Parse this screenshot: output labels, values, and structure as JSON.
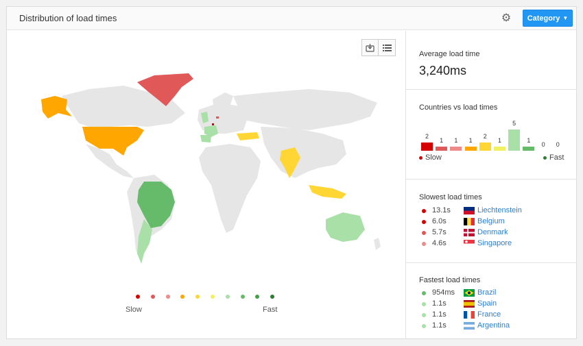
{
  "header": {
    "title": "Distribution of load times",
    "settings_icon": "gear-icon",
    "category_button": "Category"
  },
  "map": {
    "tools": [
      "export-icon",
      "menu-list-icon"
    ],
    "legend": {
      "slow_label": "Slow",
      "fast_label": "Fast"
    },
    "scale_colors": [
      "#d50000",
      "#e05858",
      "#ef8a8a",
      "#ffa700",
      "#ffd633",
      "#f0f060",
      "#a8e0a8",
      "#66bb6a",
      "#43a047",
      "#2e7d32"
    ]
  },
  "average": {
    "title": "Average load time",
    "value": "3,240ms"
  },
  "countries_vs_load": {
    "title": "Countries vs load times",
    "values": [
      2,
      1,
      1,
      1,
      2,
      1,
      5,
      1,
      0,
      0
    ],
    "colors": [
      "#d50000",
      "#e05858",
      "#ef8a8a",
      "#ffa700",
      "#ffd633",
      "#f0f060",
      "#a8e0a8",
      "#66bb6a",
      "#43a047",
      "#2e7d32"
    ],
    "slow_label": "Slow",
    "fast_label": "Fast"
  },
  "slowest": {
    "title": "Slowest load times",
    "rows": [
      {
        "time": "13.1s",
        "country": "Liechtenstein",
        "color": "#d50000"
      },
      {
        "time": "6.0s",
        "country": "Belgium",
        "color": "#d50000"
      },
      {
        "time": "5.7s",
        "country": "Denmark",
        "color": "#e05858"
      },
      {
        "time": "4.6s",
        "country": "Singapore",
        "color": "#ef8a8a"
      }
    ]
  },
  "fastest": {
    "title": "Fastest load times",
    "rows": [
      {
        "time": "954ms",
        "country": "Brazil",
        "color": "#66bb6a"
      },
      {
        "time": "1.1s",
        "country": "Spain",
        "color": "#a8e0a8"
      },
      {
        "time": "1.1s",
        "country": "France",
        "color": "#a8e0a8"
      },
      {
        "time": "1.1s",
        "country": "Argentina",
        "color": "#a8e0a8"
      }
    ]
  }
}
